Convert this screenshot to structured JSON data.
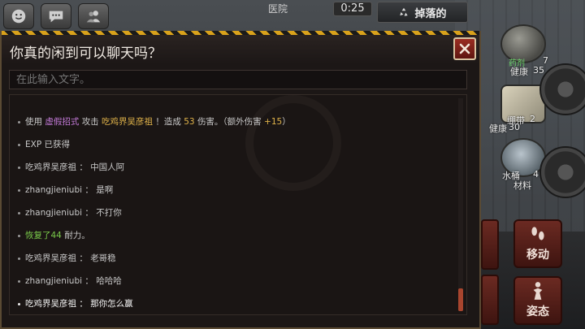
{
  "hud": {
    "location": "医院",
    "timer": "0:25",
    "drop_label": "掉落的"
  },
  "inventory": [
    {
      "tag": "药剂",
      "qty": "7",
      "name": "健康",
      "value": "35"
    },
    {
      "tag": "",
      "qty": "2",
      "name": "健康",
      "value": "30",
      "prefix": "绷带"
    },
    {
      "tag": "",
      "qty": "4",
      "name": "材料",
      "value": "",
      "prefix": "水桶"
    }
  ],
  "actions": {
    "move_label": "移动",
    "stance_label": "姿态"
  },
  "dialog": {
    "title": "你真的闲到可以聊天吗？",
    "input_placeholder": "在此输入文字。"
  },
  "chat_log": {
    "attack_line": {
      "p1": "使用",
      "skill": "虚假招式",
      "p2": "攻击",
      "target": "吃鸡界吴彦祖",
      "p3": "！造成",
      "damage": "53",
      "p4": "伤害。（额外伤害",
      "extra": "+15",
      "p5": "）"
    },
    "exp_line": "EXP 已获得",
    "messages": [
      {
        "user": "吃鸡界吴彦祖",
        "text": "中国人阿"
      },
      {
        "user": "zhangjieniubi",
        "text": "是啊"
      },
      {
        "user": "zhangjieniubi",
        "text": "不打你"
      }
    ],
    "recover_line": {
      "p1": "恢复了",
      "amount": "44",
      "p2": "耐力。"
    },
    "messages2": [
      {
        "user": "吃鸡界吴彦祖",
        "text": "老哥稳"
      },
      {
        "user": "zhangjieniubi",
        "text": "哈哈哈"
      },
      {
        "user": "吃鸡界吴彦祖",
        "text": "那你怎么赢"
      }
    ],
    "separator": "："
  },
  "colors": {
    "skill": "#c37ad8",
    "damage": "#e0b34a",
    "heal": "#7acb4a",
    "accent_red": "#a8452e",
    "hazard_stripe": "#d9a21b"
  }
}
